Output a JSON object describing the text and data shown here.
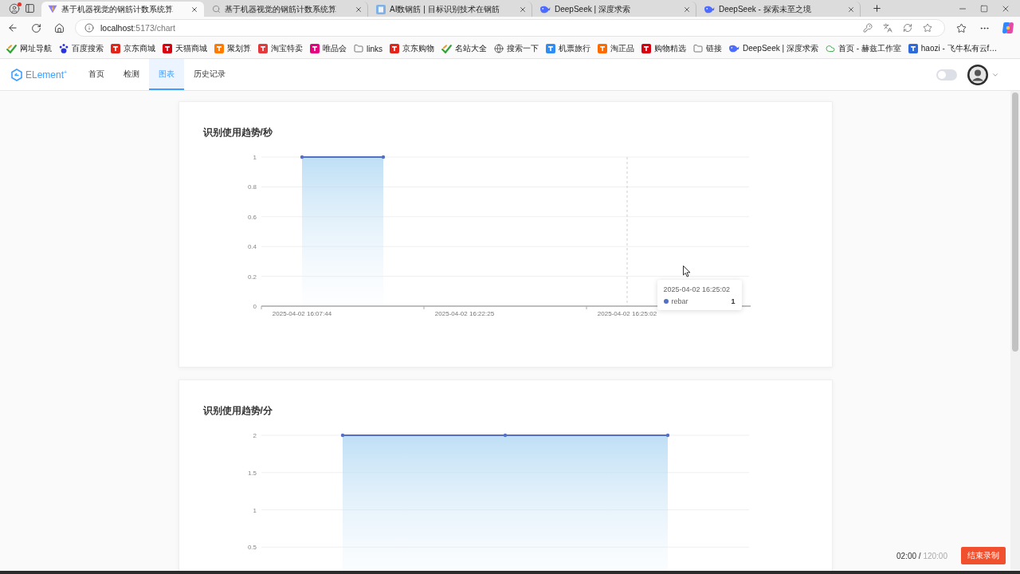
{
  "browser": {
    "tabs": [
      {
        "title": "基于机器视觉的钢筋计数系统算",
        "selected": true
      },
      {
        "title": "基于机器视觉的钢筋计数系统算",
        "selected": false
      },
      {
        "title": "AI数钢筋 | 目标识别技术在钢筋",
        "selected": false
      },
      {
        "title": "DeepSeek | 深度求索",
        "selected": false
      },
      {
        "title": "DeepSeek - 探索未至之境",
        "selected": false
      }
    ],
    "url": {
      "host": "localhost",
      "path": ":5173/chart"
    },
    "bookmarks": [
      "网址导航",
      "百度搜索",
      "京东商城",
      "天猫商城",
      "聚划算",
      "淘宝特卖",
      "唯品会",
      "links",
      "京东购物",
      "名站大全",
      "搜索一下",
      "机票旅行",
      "淘正品",
      "购物精选",
      "链接",
      "DeepSeek | 深度求索",
      "首页 - 赫兹工作室",
      "haozi - 飞牛私有云f…"
    ]
  },
  "app": {
    "logo": "ELement$^{+}$",
    "nav": [
      {
        "label": "首页",
        "selected": false
      },
      {
        "label": "检测",
        "selected": false
      },
      {
        "label": "图表",
        "selected": true
      },
      {
        "label": "历史记录",
        "selected": false
      }
    ],
    "theme_switch": {
      "on": false
    }
  },
  "charts": [
    {
      "title": "识别使用趋势/秒",
      "chart_data": {
        "type": "area",
        "categories": [
          "2025-04-02 16:07:44",
          null,
          "2025-04-02 16:22:25",
          null,
          "2025-04-02 16:25:02",
          null
        ],
        "series": [
          {
            "color": "#5470c6",
            "values": [
              1,
              1,
              null,
              null,
              null,
              null
            ]
          }
        ],
        "ylim": [
          0,
          1
        ],
        "yticks": [
          0,
          0.2,
          0.4,
          0.6,
          0.8,
          1
        ],
        "grid": true
      },
      "tooltip": {
        "title": "2025-04-02 16:25:02",
        "items": [
          {
            "name": "rebar",
            "value": "1",
            "color": "#5470c6"
          }
        ]
      }
    },
    {
      "title": "识别使用趋势/分",
      "chart_data": {
        "type": "area",
        "categories": [
          null,
          null,
          null
        ],
        "series": [
          {
            "color": "#5470c6",
            "values": [
              2,
              2,
              2
            ]
          }
        ],
        "ylim": [
          0,
          2
        ],
        "yticks": [
          0.5,
          1,
          1.5,
          2
        ],
        "grid": true
      }
    }
  ],
  "recorder": {
    "elapsed": "02:00",
    "separator": "/",
    "total": "120:00",
    "stop_label": "结束录制"
  }
}
